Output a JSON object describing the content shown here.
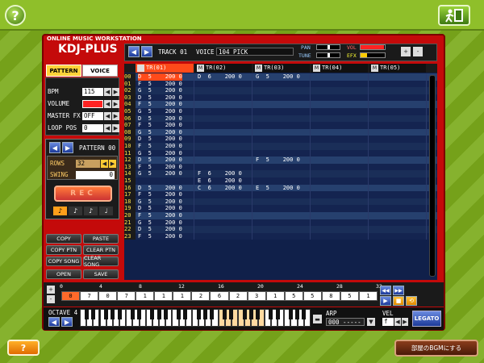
{
  "topbar": {
    "help_icon": "?",
    "exit_icon": "exit-door-icon"
  },
  "app": {
    "subtitle": "ONLINE MUSIC WORKSTATION",
    "logo": "KDJ-PLUS"
  },
  "header": {
    "track_label": "TRACK 01",
    "voice_label": "VOICE",
    "voice_value": "104 PICK",
    "pan_label": "PAN",
    "tune_label": "TUNE",
    "vol_label": "VOL",
    "efx_label": "EFX",
    "plus": "+",
    "minus": "-"
  },
  "tabs": {
    "pattern": "PATTERN",
    "voice": "VOICE"
  },
  "params": [
    {
      "label": "BPM",
      "value": "115"
    },
    {
      "label": "VOLUME",
      "value": ""
    },
    {
      "label": "MASTER FX",
      "value": "OFF"
    },
    {
      "label": "LOOP POS",
      "value": "0"
    }
  ],
  "pattern": {
    "label": "PATTERN 00",
    "rows_label": "ROWS",
    "rows_value": "32",
    "swing_label": "SWING",
    "swing_value": "0",
    "rec": "REC"
  },
  "buttons": {
    "copy": "COPY",
    "paste": "PASTE",
    "copy_ptn": "COPY PTN",
    "clear_ptn": "CLEAR PTN",
    "copy_song": "COPY SONG",
    "clear_song": "CLEAR SONG",
    "open": "OPEN",
    "save": "SAVE"
  },
  "tracks": [
    "TR(01)",
    "TR(02)",
    "TR(03)",
    "TR(04)",
    "TR(05)"
  ],
  "track_mute": [
    "M",
    "M",
    "M",
    "M"
  ],
  "rows": [
    {
      "n": "00",
      "t1": "D  5    200 0",
      "t2": "D  6    200 0",
      "t3": "G  5    200 0"
    },
    {
      "n": "01",
      "t1": "F  5    200 0",
      "t2": "",
      "t3": ""
    },
    {
      "n": "02",
      "t1": "G  5    200 0",
      "t2": "",
      "t3": ""
    },
    {
      "n": "03",
      "t1": "D  5    200 0",
      "t2": "",
      "t3": ""
    },
    {
      "n": "04",
      "t1": "F  5    200 0",
      "t2": "",
      "t3": ""
    },
    {
      "n": "05",
      "t1": "G  5    200 0",
      "t2": "",
      "t3": ""
    },
    {
      "n": "06",
      "t1": "D  5    200 0",
      "t2": "",
      "t3": ""
    },
    {
      "n": "07",
      "t1": "F  5    200 0",
      "t2": "",
      "t3": ""
    },
    {
      "n": "08",
      "t1": "G  5    200 0",
      "t2": "",
      "t3": ""
    },
    {
      "n": "09",
      "t1": "D  5    200 0",
      "t2": "",
      "t3": ""
    },
    {
      "n": "10",
      "t1": "F  5    200 0",
      "t2": "",
      "t3": ""
    },
    {
      "n": "11",
      "t1": "G  5    200 0",
      "t2": "",
      "t3": ""
    },
    {
      "n": "12",
      "t1": "D  5    200 0",
      "t2": "",
      "t3": "F  5    200 0"
    },
    {
      "n": "13",
      "t1": "F  5    200 0",
      "t2": "",
      "t3": ""
    },
    {
      "n": "14",
      "t1": "G  5    200 0",
      "t2": "F  6    200 0",
      "t3": ""
    },
    {
      "n": "15",
      "t1": "",
      "t2": "E  6    200 0",
      "t3": ""
    },
    {
      "n": "16",
      "t1": "D  5    200 0",
      "t2": "C  6    200 0",
      "t3": "E  5    200 0"
    },
    {
      "n": "17",
      "t1": "F  5    200 0",
      "t2": "",
      "t3": ""
    },
    {
      "n": "18",
      "t1": "G  5    200 0",
      "t2": "",
      "t3": ""
    },
    {
      "n": "19",
      "t1": "D  5    200 0",
      "t2": "",
      "t3": ""
    },
    {
      "n": "20",
      "t1": "F  5    200 0",
      "t2": "",
      "t3": ""
    },
    {
      "n": "21",
      "t1": "G  5    200 0",
      "t2": "",
      "t3": ""
    },
    {
      "n": "22",
      "t1": "D  5    200 0",
      "t2": "",
      "t3": ""
    },
    {
      "n": "23",
      "t1": "F  5    200 0",
      "t2": "",
      "t3": ""
    }
  ],
  "sequence": {
    "ruler": [
      "0",
      "4",
      "8",
      "12",
      "16",
      "20",
      "24",
      "28",
      "32"
    ],
    "cells": [
      "0",
      "7",
      "0",
      "7",
      "1",
      "1",
      "1",
      "2",
      "6",
      "2",
      "3",
      "1",
      "5",
      "5",
      "8",
      "5",
      "1"
    ]
  },
  "keyboard": {
    "octave_label": "OCTAVE 4",
    "arp_label": "ARP",
    "arp_value": "000 -----",
    "vel_label": "VEL",
    "vel_value": "f",
    "legato": "LEGATO"
  },
  "footer": {
    "help": "?",
    "bgm": "部屋のBGMにする"
  },
  "colors": {
    "frame_red": "#c40a0a",
    "grid_blue": "#10204a",
    "accent_orange": "#ff8a00",
    "background_green": "#7cab1c"
  }
}
